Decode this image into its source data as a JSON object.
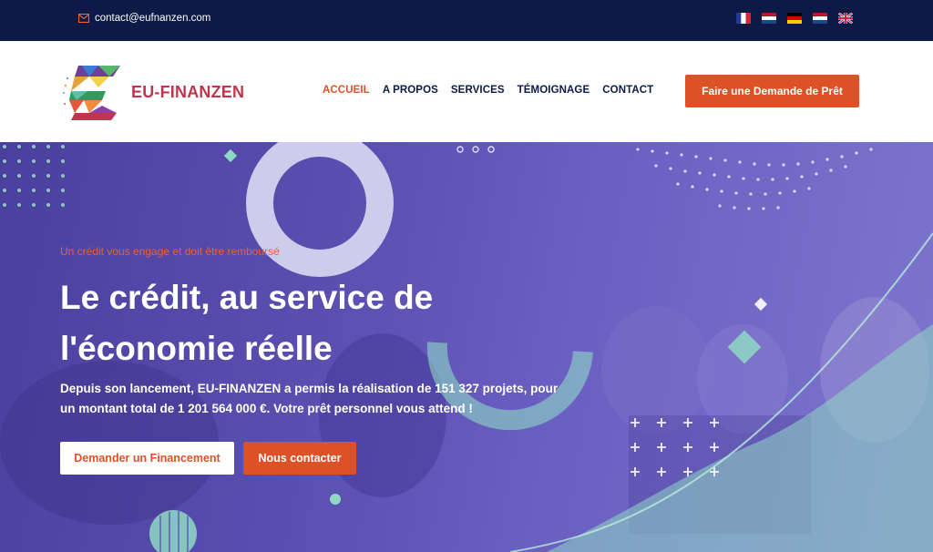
{
  "topbar": {
    "email": "contact@eufnanzen.com",
    "email_icon": "envelope-icon",
    "flags": [
      {
        "name": "flag-fr-icon",
        "lang": "fr"
      },
      {
        "name": "flag-nl-icon",
        "lang": "nl"
      },
      {
        "name": "flag-de-icon",
        "lang": "de"
      },
      {
        "name": "flag-nl-icon",
        "lang": "nl"
      },
      {
        "name": "flag-uk-icon",
        "lang": "en"
      }
    ]
  },
  "header": {
    "brand": "EU-FINANZEN",
    "nav": [
      "ACCUEIL",
      "A PROPOS",
      "SERVICES",
      "TÉMOIGNAGE",
      "CONTACT"
    ],
    "active_nav": "ACCUEIL",
    "cta_label": "Faire une Demande de Prêt"
  },
  "hero": {
    "kicker": "Un crédit vous engage et doit être remboursé",
    "headline": "Le crédit, au service de l'économie réelle",
    "lead": "Depuis son lancement, EU-FINANZEN a permis la réalisation de 151 327 projets, pour un montant total de 1 201 564 000 €. Votre prêt personnel vous attend !",
    "btn_primary": "Demander un Financement",
    "btn_secondary": "Nous contacter"
  },
  "colors": {
    "topbar": "#0c1a45",
    "accent": "#dd5127",
    "brand_text": "#c1344e",
    "hero": "#5a4eb0",
    "mint": "#8fd8c4"
  }
}
